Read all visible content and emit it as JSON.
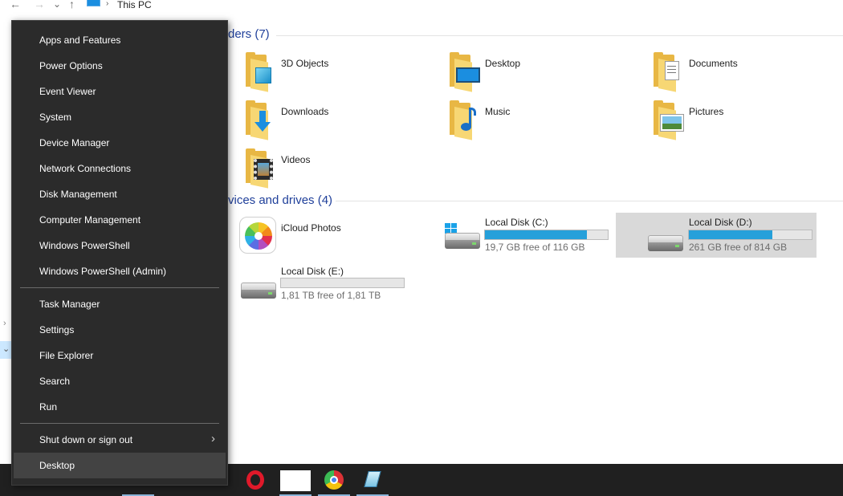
{
  "explorer": {
    "breadcrumb": "This PC",
    "nav": {
      "back": "←",
      "forward": "→",
      "recent": "⌄",
      "up": "↑",
      "sep": "›"
    },
    "folders_header": "ders (7)",
    "folders": [
      {
        "label": "3D Objects",
        "icon": "3d-objects-icon"
      },
      {
        "label": "Desktop",
        "icon": "desktop-folder-icon"
      },
      {
        "label": "Documents",
        "icon": "documents-folder-icon"
      },
      {
        "label": "Downloads",
        "icon": "downloads-folder-icon"
      },
      {
        "label": "Music",
        "icon": "music-folder-icon"
      },
      {
        "label": "Pictures",
        "icon": "pictures-folder-icon"
      },
      {
        "label": "Videos",
        "icon": "videos-folder-icon"
      }
    ],
    "drives_header": "vices and drives (4)",
    "drives": [
      {
        "label": "iCloud Photos",
        "icon": "icloud-photos-icon"
      },
      {
        "label": "Local Disk (C:)",
        "free": "19,7 GB free of 116 GB",
        "used_fraction": 0.83,
        "icon": "windows-drive-icon"
      },
      {
        "label": "Local Disk (D:)",
        "free": "261 GB free of 814 GB",
        "used_fraction": 0.68,
        "selected": true,
        "icon": "hard-drive-icon"
      },
      {
        "label": "Local Disk (E:)",
        "free": "1,81 TB free of 1,81 TB",
        "used_fraction": 0.0,
        "icon": "hard-drive-icon"
      }
    ]
  },
  "winx_menu": {
    "items": [
      "Apps and Features",
      "Power Options",
      "Event Viewer",
      "System",
      "Device Manager",
      "Network Connections",
      "Disk Management",
      "Computer Management",
      "Windows PowerShell",
      "Windows PowerShell (Admin)",
      "Task Manager",
      "Settings",
      "File Explorer",
      "Search",
      "Run",
      "Shut down or sign out",
      "Desktop"
    ],
    "submenu_arrow": "›",
    "highlighted": "Desktop"
  },
  "taskbar": {
    "apps": [
      "opera-icon",
      "blank-window-icon",
      "chrome-icon",
      "notepad-icon"
    ]
  },
  "colors": {
    "accent": "#26a0da",
    "menu_bg": "#2b2b2b",
    "taskbar": "#202020",
    "header_blue": "#1f3f9a"
  }
}
